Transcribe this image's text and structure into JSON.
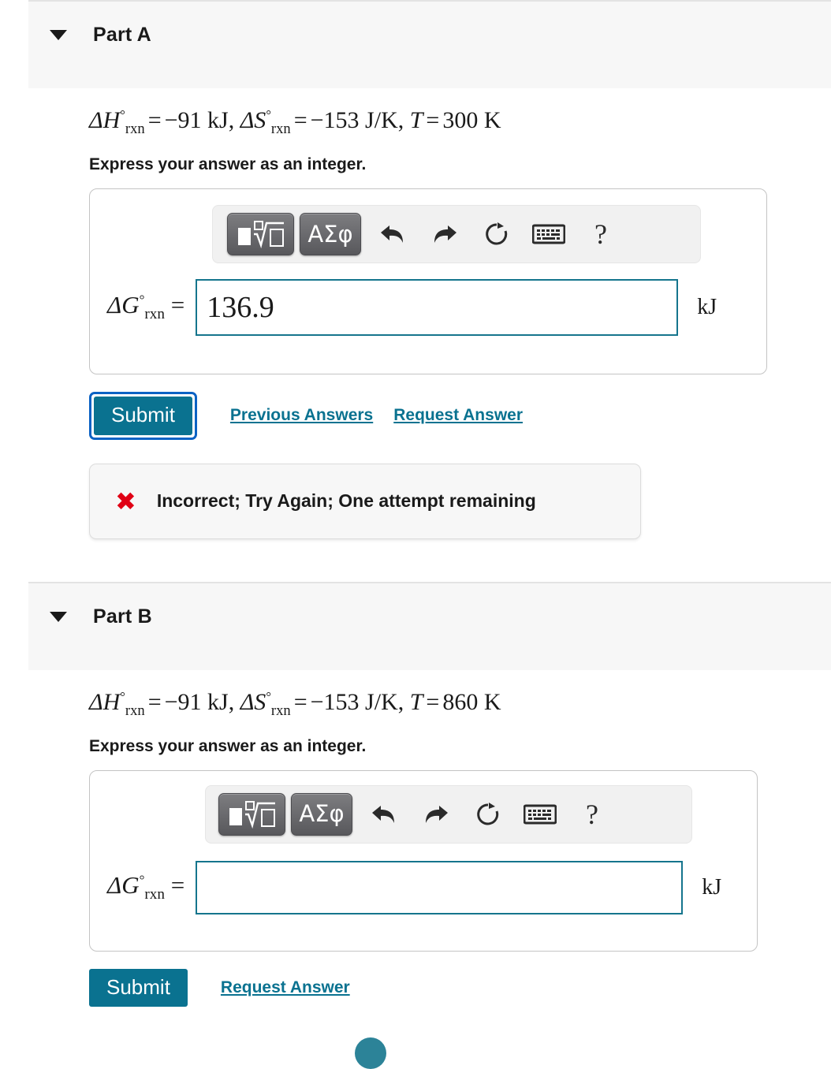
{
  "parts": [
    {
      "id": "a",
      "title": "Part A",
      "caret_icon": "caret-down-icon",
      "statement": {
        "h_symbol": "ΔH",
        "h_sub": "rxn",
        "h_value": "−91 kJ",
        "s_symbol": "ΔS",
        "s_sub": "rxn",
        "s_value": "−153 J/K",
        "t_symbol": "T",
        "t_value": "300 K",
        "plain": "ΔH°rxn = −91 kJ, ΔS°rxn = −153 J/K, T = 300 K"
      },
      "instruction": "Express your answer as an integer.",
      "toolbar": {
        "template_button": "math-template",
        "greek_button": "ΑΣφ",
        "undo": "undo-arrow",
        "redo": "redo-arrow",
        "reset": "reset-circular-arrow",
        "keyboard": "keyboard",
        "help": "?"
      },
      "answer": {
        "label_symbol": "ΔG",
        "label_sub": "rxn",
        "label_equals": "=",
        "value": "136.9",
        "placeholder": "",
        "unit": "kJ"
      },
      "submit_label": "Submit",
      "links": [
        "Previous Answers",
        "Request Answer"
      ],
      "feedback": {
        "icon": "red-x-icon",
        "icon_glyph": "✖",
        "text": "Incorrect; Try Again; One attempt remaining",
        "color": "#e00015"
      }
    },
    {
      "id": "b",
      "title": "Part B",
      "caret_icon": "caret-down-icon",
      "statement": {
        "h_symbol": "ΔH",
        "h_sub": "rxn",
        "h_value": "−91 kJ",
        "s_symbol": "ΔS",
        "s_sub": "rxn",
        "s_value": "−153 J/K",
        "t_symbol": "T",
        "t_value": "860 K",
        "plain": "ΔH°rxn = −91 kJ, ΔS°rxn = −153 J/K, T = 860 K"
      },
      "instruction": "Express your answer as an integer.",
      "toolbar": {
        "template_button": "math-template",
        "greek_button": "ΑΣφ",
        "undo": "undo-arrow",
        "redo": "redo-arrow",
        "reset": "reset-circular-arrow",
        "keyboard": "keyboard",
        "help": "?"
      },
      "answer": {
        "label_symbol": "ΔG",
        "label_sub": "rxn",
        "label_equals": "=",
        "value": "",
        "placeholder": "",
        "unit": "kJ"
      },
      "submit_label": "Submit",
      "links": [
        "Request Answer"
      ],
      "feedback": null
    }
  ],
  "colors": {
    "accent_teal": "#0a7290",
    "focus_blue": "#0b62c4",
    "error_red": "#e00015",
    "header_band": "#f7f7f7",
    "input_border": "#15758d"
  }
}
